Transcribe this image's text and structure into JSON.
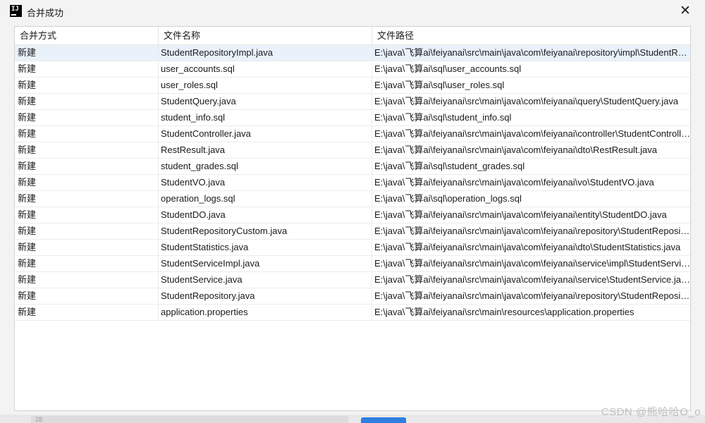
{
  "window": {
    "title": "合并成功",
    "app_icon_text": "IJ",
    "close_glyph": "✕"
  },
  "table": {
    "columns": [
      "合并方式",
      "文件名称",
      "文件路径"
    ],
    "rows": [
      {
        "mode": "新建",
        "name": "StudentRepositoryImpl.java",
        "path": "E:\\java\\飞算ai\\feiyanai\\src\\main\\java\\com\\feiyanai\\repository\\impl\\StudentRepositoryImpl.java"
      },
      {
        "mode": "新建",
        "name": "user_accounts.sql",
        "path": "E:\\java\\飞算ai\\sql\\user_accounts.sql"
      },
      {
        "mode": "新建",
        "name": "user_roles.sql",
        "path": "E:\\java\\飞算ai\\sql\\user_roles.sql"
      },
      {
        "mode": "新建",
        "name": "StudentQuery.java",
        "path": "E:\\java\\飞算ai\\feiyanai\\src\\main\\java\\com\\feiyanai\\query\\StudentQuery.java"
      },
      {
        "mode": "新建",
        "name": "student_info.sql",
        "path": "E:\\java\\飞算ai\\sql\\student_info.sql"
      },
      {
        "mode": "新建",
        "name": "StudentController.java",
        "path": "E:\\java\\飞算ai\\feiyanai\\src\\main\\java\\com\\feiyanai\\controller\\StudentController.java"
      },
      {
        "mode": "新建",
        "name": "RestResult.java",
        "path": "E:\\java\\飞算ai\\feiyanai\\src\\main\\java\\com\\feiyanai\\dto\\RestResult.java"
      },
      {
        "mode": "新建",
        "name": "student_grades.sql",
        "path": "E:\\java\\飞算ai\\sql\\student_grades.sql"
      },
      {
        "mode": "新建",
        "name": "StudentVO.java",
        "path": "E:\\java\\飞算ai\\feiyanai\\src\\main\\java\\com\\feiyanai\\vo\\StudentVO.java"
      },
      {
        "mode": "新建",
        "name": "operation_logs.sql",
        "path": "E:\\java\\飞算ai\\sql\\operation_logs.sql"
      },
      {
        "mode": "新建",
        "name": "StudentDO.java",
        "path": "E:\\java\\飞算ai\\feiyanai\\src\\main\\java\\com\\feiyanai\\entity\\StudentDO.java"
      },
      {
        "mode": "新建",
        "name": "StudentRepositoryCustom.java",
        "path": "E:\\java\\飞算ai\\feiyanai\\src\\main\\java\\com\\feiyanai\\repository\\StudentRepositoryCustom.java"
      },
      {
        "mode": "新建",
        "name": "StudentStatistics.java",
        "path": "E:\\java\\飞算ai\\feiyanai\\src\\main\\java\\com\\feiyanai\\dto\\StudentStatistics.java"
      },
      {
        "mode": "新建",
        "name": "StudentServiceImpl.java",
        "path": "E:\\java\\飞算ai\\feiyanai\\src\\main\\java\\com\\feiyanai\\service\\impl\\StudentServiceImpl.java"
      },
      {
        "mode": "新建",
        "name": "StudentService.java",
        "path": "E:\\java\\飞算ai\\feiyanai\\src\\main\\java\\com\\feiyanai\\service\\StudentService.java"
      },
      {
        "mode": "新建",
        "name": "StudentRepository.java",
        "path": "E:\\java\\飞算ai\\feiyanai\\src\\main\\java\\com\\feiyanai\\repository\\StudentRepository.java"
      },
      {
        "mode": "新建",
        "name": "application.properties",
        "path": "E:\\java\\飞算ai\\feiyanai\\src\\main\\resources\\application.properties"
      }
    ]
  },
  "background": {
    "line_number": "28",
    "selection_color": "#e9f1fb",
    "accent_color": "#2f7de1"
  },
  "watermark": "CSDN @熊哈哈O_o"
}
